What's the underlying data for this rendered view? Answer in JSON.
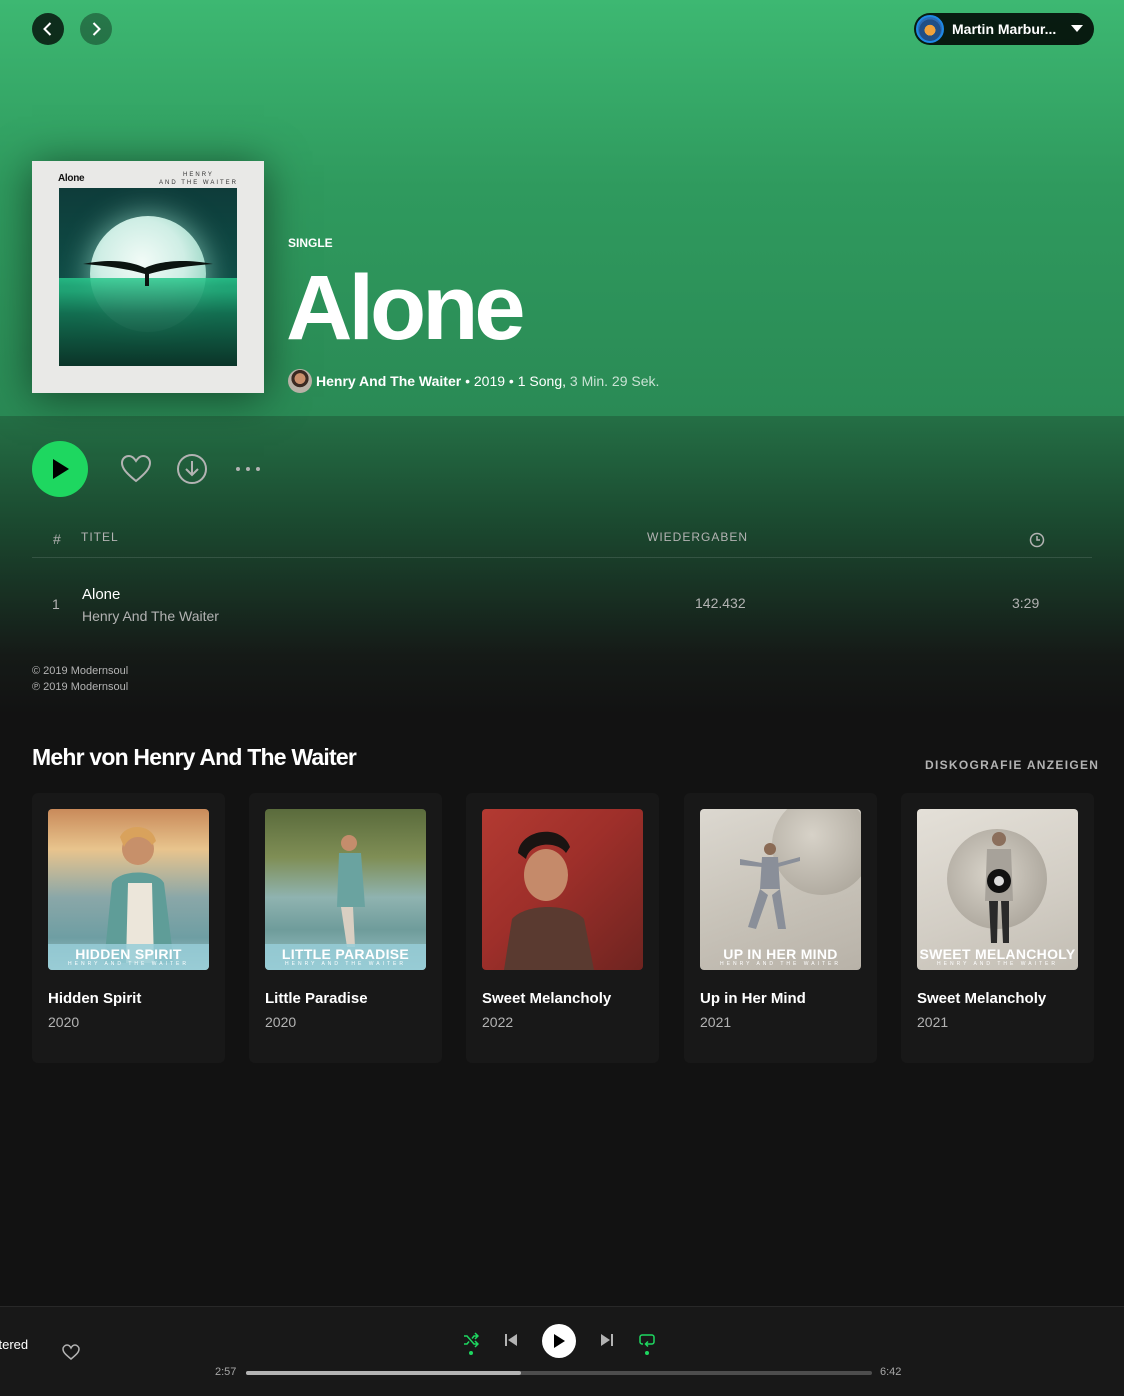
{
  "header": {
    "user_name": "Martin Marbur..."
  },
  "album": {
    "kind": "SINGLE",
    "title": "Alone",
    "cover_title": "Alone",
    "cover_artist_line1": "HENRY",
    "cover_artist_line2": "AND THE WAITER",
    "artist": "Henry And The Waiter",
    "year": "2019",
    "song_count": "1 Song,",
    "duration": "3 Min. 29 Sek."
  },
  "table": {
    "col_num": "#",
    "col_title": "TITEL",
    "col_plays": "WIEDERGABEN"
  },
  "tracks": [
    {
      "num": "1",
      "title": "Alone",
      "artist": "Henry And The Waiter",
      "plays": "142.432",
      "duration": "3:29"
    }
  ],
  "copyright": {
    "c_line": "© 2019 Modernsoul",
    "p_line": "℗ 2019 Modernsoul"
  },
  "more": {
    "title": "Mehr von Henry And The Waiter",
    "link": "DISKOGRAFIE ANZEIGEN",
    "cards": [
      {
        "name": "Hidden Spirit",
        "year": "2020",
        "band_title": "HIDDEN SPIRIT",
        "band_sub": "HENRY AND THE WAITER"
      },
      {
        "name": "Little Paradise",
        "year": "2020",
        "band_title": "LITTLE PARADISE",
        "band_sub": "HENRY AND THE WAITER"
      },
      {
        "name": "Sweet Melancholy",
        "year": "2022",
        "band_title": "",
        "band_sub": ""
      },
      {
        "name": "Up in Her Mind",
        "year": "2021",
        "band_title": "UP IN HER MIND",
        "band_sub": "HENRY AND THE WAITER"
      },
      {
        "name": "Sweet Melancholy",
        "year": "2021",
        "band_title": "SWEET MELANCHOLY",
        "band_sub": "HENRY AND THE WAITER"
      }
    ]
  },
  "player": {
    "now_playing_fragment": "stered",
    "elapsed": "2:57",
    "total": "6:42",
    "progress_fraction": 0.44
  },
  "colors": {
    "accent": "#1ed760",
    "hero_top": "#3db872",
    "background": "#121212"
  }
}
